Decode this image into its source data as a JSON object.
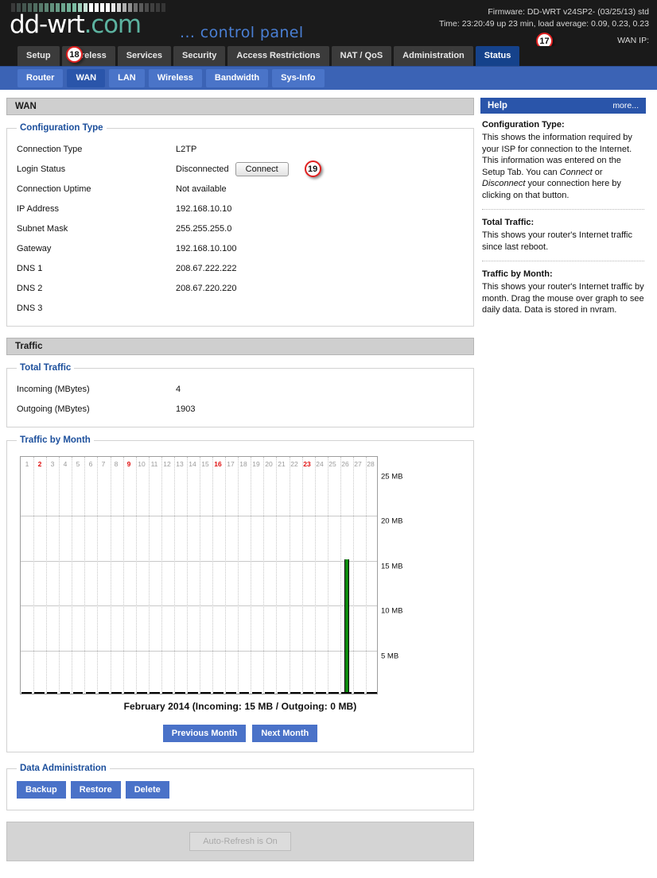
{
  "header": {
    "logo_main": "dd-wrt",
    "logo_suffix": ".com",
    "control_panel": "... control panel",
    "firmware": "Firmware: DD-WRT v24SP2- (03/25/13) std",
    "time": "Time: 23:20:49 up 23 min, load average: 0.09, 0.23, 0.23",
    "wan_ip": "WAN IP:"
  },
  "tabs": [
    {
      "label": "Setup",
      "active": false
    },
    {
      "label": "Wireless",
      "active": false
    },
    {
      "label": "Services",
      "active": false
    },
    {
      "label": "Security",
      "active": false
    },
    {
      "label": "Access Restrictions",
      "active": false
    },
    {
      "label": "NAT / QoS",
      "active": false
    },
    {
      "label": "Administration",
      "active": false
    },
    {
      "label": "Status",
      "active": true
    }
  ],
  "subtabs": [
    {
      "label": "Router",
      "active": false
    },
    {
      "label": "WAN",
      "active": true
    },
    {
      "label": "LAN",
      "active": false
    },
    {
      "label": "Wireless",
      "active": false
    },
    {
      "label": "Bandwidth",
      "active": false
    },
    {
      "label": "Sys-Info",
      "active": false
    }
  ],
  "markers": [
    {
      "id": "17",
      "label": "17"
    },
    {
      "id": "18",
      "label": "18"
    },
    {
      "id": "19",
      "label": "19"
    }
  ],
  "page_title": "WAN",
  "configuration_type": {
    "legend": "Configuration Type",
    "rows": [
      {
        "label": "Connection Type",
        "value": "L2TP"
      },
      {
        "label": "Login Status",
        "value": "Disconnected"
      },
      {
        "label": "Connection Uptime",
        "value": "Not available"
      },
      {
        "label": "IP Address",
        "value": "192.168.10.10"
      },
      {
        "label": "Subnet Mask",
        "value": "255.255.255.0"
      },
      {
        "label": "Gateway",
        "value": "192.168.10.100"
      },
      {
        "label": "DNS 1",
        "value": "208.67.222.222"
      },
      {
        "label": "DNS 2",
        "value": "208.67.220.220"
      },
      {
        "label": "DNS 3",
        "value": ""
      }
    ],
    "connect_button": "Connect"
  },
  "traffic": {
    "title": "Traffic",
    "total_legend": "Total Traffic",
    "rows": [
      {
        "label": "Incoming (MBytes)",
        "value": "4"
      },
      {
        "label": "Outgoing (MBytes)",
        "value": "1903"
      }
    ],
    "by_month_legend": "Traffic by Month",
    "previous_month": "Previous Month",
    "next_month": "Next Month"
  },
  "data_administration": {
    "legend": "Data Administration",
    "backup": "Backup",
    "restore": "Restore",
    "delete": "Delete"
  },
  "auto_refresh": "Auto-Refresh is On",
  "help": {
    "title": "Help",
    "more": "more...",
    "sections": [
      {
        "heading": "Configuration Type:",
        "body": "This shows the information required by your ISP for connection to the Internet. This information was entered on the Setup Tab. You can Connect or Disconnect your connection here by clicking on that button."
      },
      {
        "heading": "Total Traffic:",
        "body": "This shows your router's Internet traffic since last reboot."
      },
      {
        "heading": "Traffic by Month:",
        "body": "This shows your router's Internet traffic by month. Drag the mouse over graph to see daily data. Data is stored in nvram."
      }
    ]
  },
  "colors": {
    "accent_blue": "#2a55aa",
    "tab_blue": "#4a74c8",
    "bar_green": "#0a8a0a",
    "marker_red": "#e02020",
    "sunday_red": "#e01010"
  },
  "chart_data": {
    "type": "bar",
    "title": "February 2014 (Incoming: 15 MB / Outgoing: 0 MB)",
    "month": "February 2014",
    "incoming_total": "15 MB",
    "outgoing_total": "0 MB",
    "xlabel": "",
    "ylabel": "",
    "ylim": [
      0,
      25
    ],
    "yticks": [
      5,
      10,
      15,
      20,
      25
    ],
    "ytick_labels": [
      "5 MB",
      "10 MB",
      "15 MB",
      "20 MB",
      "25 MB"
    ],
    "grid": true,
    "legend": "none",
    "categories": [
      1,
      2,
      3,
      4,
      5,
      6,
      7,
      8,
      9,
      10,
      11,
      12,
      13,
      14,
      15,
      16,
      17,
      18,
      19,
      20,
      21,
      22,
      23,
      24,
      25,
      26,
      27,
      28
    ],
    "sundays": [
      2,
      9,
      16,
      23
    ],
    "series": [
      {
        "name": "Incoming",
        "color": "#0a8a0a",
        "values": [
          0,
          0,
          0,
          0,
          0,
          0,
          0,
          0,
          0,
          0,
          0,
          0,
          0,
          0,
          0,
          0,
          0,
          0,
          0,
          0,
          0,
          0,
          0,
          0,
          0,
          15,
          0,
          0
        ]
      },
      {
        "name": "Outgoing",
        "color": "#000000",
        "values": [
          0,
          0,
          0,
          0,
          0,
          0,
          0,
          0,
          0,
          0,
          0,
          0,
          0,
          0,
          0,
          0,
          0,
          0,
          0,
          0,
          0,
          0,
          0,
          0,
          0,
          0,
          0,
          0
        ]
      }
    ]
  }
}
